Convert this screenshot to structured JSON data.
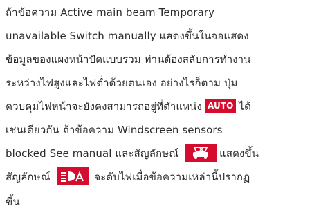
{
  "paragraph": {
    "line1": "ถ้าข้อความ Active main beam Temporary",
    "line2": "unavailable Switch manually แสดงขึ้นในจอแสดง",
    "line3": "ข้อมูลของแผงหน้าปัดแบบรวม ท่านต้องสลับการทำงาน",
    "line4": "ระหว่างไฟสูงและไฟต่ำด้วยตนเอง อย่างไรก็ตาม ปุ่ม",
    "line5a": "ควบคุมไฟหน้าจะยังคงสามารถอยู่ที่ตำแหน่ง",
    "badge_auto": "AUTO",
    "line5b": "ได้",
    "line6": "เช่นเดียวกัน ถ้าข้อความ Windscreen sensors",
    "line7a": "blocked See manual และสัญลักษณ์",
    "line7b": "แสดงขึ้น",
    "line8a": "สัญลักษณ์",
    "line8b": "จะดับไฟเมื่อข้อความเหล่านี้ปรากฏ",
    "line9": "ขึ้น"
  },
  "icons": {
    "windscreen_sensor": "windscreen-sensor-icon",
    "auto_headlight": "auto-headlight-icon"
  },
  "colors": {
    "badge_background": "#d40c2e",
    "text": "#2b2b2b"
  }
}
